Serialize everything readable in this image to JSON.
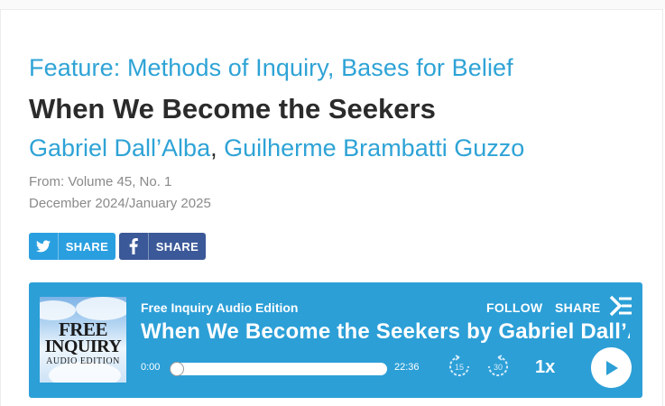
{
  "article": {
    "feature": "Feature: Methods of Inquiry, Bases for Belief",
    "title": "When We Become the Seekers",
    "authors": [
      "Gabriel Dall’Alba",
      "Guilherme Brambatti Guzzo"
    ],
    "author_separator": ",",
    "from": "From: Volume 45, No. 1",
    "date": "December 2024/January 2025"
  },
  "share": {
    "twitter_label": "SHARE",
    "facebook_label": "SHARE"
  },
  "player": {
    "cover": {
      "line1": "FREE",
      "line2": "INQUIRY",
      "line3": "AUDIO EDITION"
    },
    "source": "Free Inquiry Audio Edition",
    "follow_label": "FOLLOW",
    "share_label": "SHARE",
    "episode_title": "When We Become the Seekers by Gabriel Dall’A",
    "time_elapsed": "0:00",
    "time_total": "22:36",
    "progress": 0,
    "skip_back_seconds": "15",
    "skip_forward_seconds": "30",
    "speed": "1x"
  },
  "icons": {
    "twitter": "twitter-icon",
    "facebook": "facebook-icon",
    "logo": "spreaker-logo-icon",
    "skip_back": "rewind-15-icon",
    "skip_forward": "forward-30-icon",
    "play": "play-icon"
  },
  "colors": {
    "accent": "#2ea3d6",
    "player_bg": "#2c9fd7",
    "twitter": "#2a9fe0",
    "facebook": "#3b5998",
    "title": "#2b2b2b",
    "meta": "#8a8a8a"
  }
}
